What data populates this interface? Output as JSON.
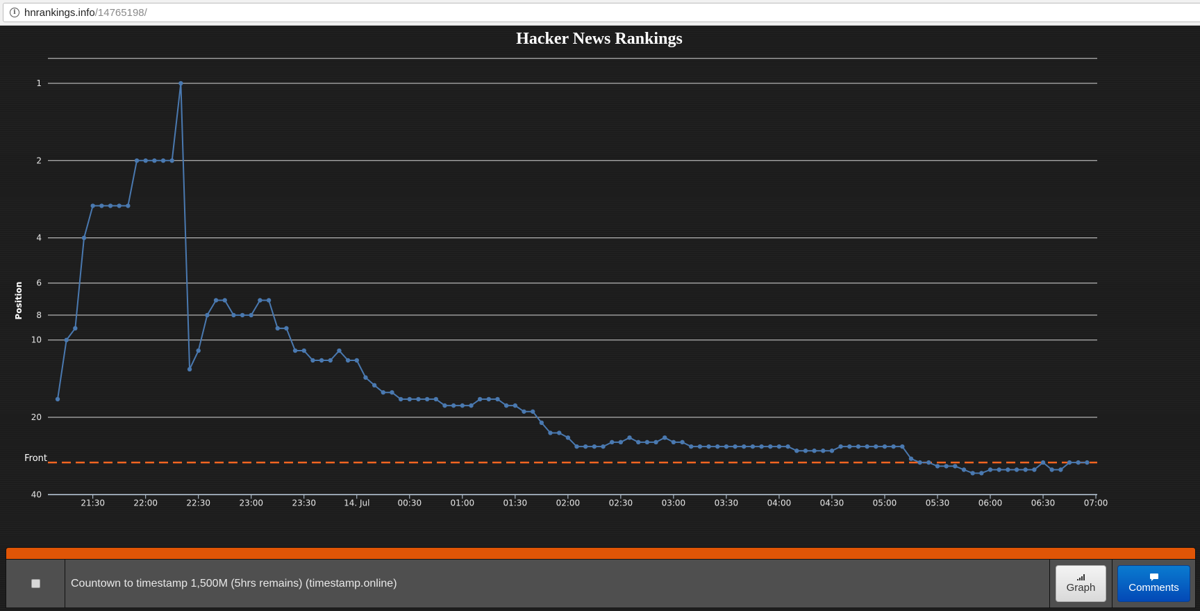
{
  "browser": {
    "url_host": "hnrankings.info",
    "url_path": "/14765198/",
    "info_icon": "info-icon"
  },
  "chart_data": {
    "type": "line",
    "title": "Hacker News Rankings",
    "xlabel": "",
    "ylabel": "Position",
    "y_scale": "log",
    "y_reversed": true,
    "ylim": [
      0.8,
      40
    ],
    "y_ticks": [
      1,
      2,
      4,
      6,
      8,
      10,
      20,
      40
    ],
    "y_tick_labels": [
      "1",
      "2",
      "4",
      "6",
      "8",
      "10",
      "20",
      "40"
    ],
    "x_tick_labels": [
      "21:30",
      "22:00",
      "22:30",
      "23:00",
      "23:30",
      "14. Jul",
      "00:30",
      "01:00",
      "01:30",
      "02:00",
      "02:30",
      "03:00",
      "03:30",
      "04:00",
      "04:30",
      "05:00",
      "05:30",
      "06:00",
      "06:30",
      "07:00"
    ],
    "x_start": "21:10",
    "x_interval_minutes": 5,
    "grid": true,
    "plot_lines": [
      {
        "label": "Front",
        "value": 30,
        "color": "#f26522",
        "style": "dashed"
      }
    ],
    "series": [
      {
        "name": "Position",
        "color": "#4a79b0",
        "values": [
          17,
          10,
          9,
          4,
          3,
          3,
          3,
          3,
          3,
          2,
          2,
          2,
          2,
          2,
          1,
          13,
          11,
          8,
          7,
          7,
          8,
          8,
          8,
          7,
          7,
          9,
          9,
          11,
          11,
          12,
          12,
          12,
          11,
          12,
          12,
          14,
          15,
          16,
          16,
          17,
          17,
          17,
          17,
          17,
          18,
          18,
          18,
          18,
          17,
          17,
          17,
          18,
          18,
          19,
          19,
          21,
          23,
          23,
          24,
          26,
          26,
          26,
          26,
          25,
          25,
          24,
          25,
          25,
          25,
          24,
          25,
          25,
          26,
          26,
          26,
          26,
          26,
          26,
          26,
          26,
          26,
          26,
          26,
          26,
          27,
          27,
          27,
          27,
          27,
          26,
          26,
          26,
          26,
          26,
          26,
          26,
          26,
          29,
          30,
          30,
          31,
          31,
          31,
          32,
          33,
          33,
          32,
          32,
          32,
          32,
          32,
          32,
          30,
          32,
          32,
          30,
          30,
          30
        ]
      }
    ]
  },
  "bottom_bar": {
    "story_text": "Countown to timestamp 1,500M (5hrs remains) (timestamp.online)",
    "graph_button": "Graph",
    "comments_button": "Comments",
    "accent_color": "#e05506"
  }
}
